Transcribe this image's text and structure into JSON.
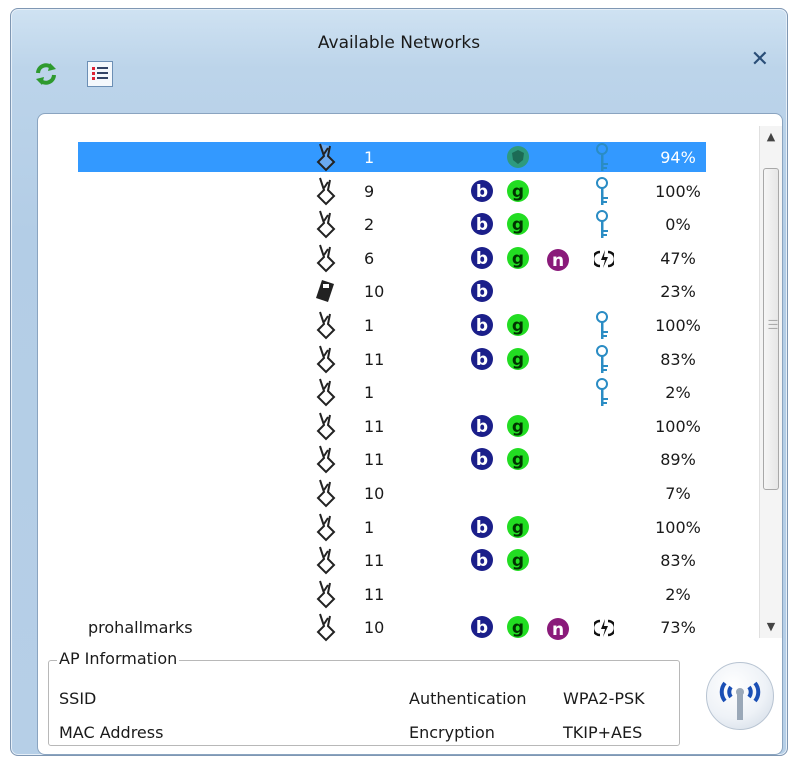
{
  "window": {
    "title": "Available Networks"
  },
  "toolbar": {
    "refresh_icon": "refresh-icon",
    "list_icon": "list-view-icon",
    "close_label": "✕"
  },
  "colors": {
    "selection": "#3399ff",
    "b_badge": "#1b1f8a",
    "g_badge": "#22dd22",
    "n_badge": "#8a1a7a",
    "key": "#2a8cc4"
  },
  "networks": [
    {
      "ssid": "",
      "type": "infrastructure",
      "channel": "1",
      "b": false,
      "g": false,
      "n": false,
      "special": "shield",
      "secured": true,
      "signal": "94%",
      "selected": true
    },
    {
      "ssid": "",
      "type": "infrastructure",
      "channel": "9",
      "b": true,
      "g": true,
      "n": false,
      "secured": true,
      "signal": "100%"
    },
    {
      "ssid": "",
      "type": "infrastructure",
      "channel": "2",
      "b": true,
      "g": true,
      "n": false,
      "secured": true,
      "signal": "0%"
    },
    {
      "ssid": "",
      "type": "infrastructure",
      "channel": "6",
      "b": true,
      "g": true,
      "n": true,
      "wps": true,
      "secured": false,
      "signal": "47%"
    },
    {
      "ssid": "",
      "type": "adhoc",
      "channel": "10",
      "b": true,
      "g": false,
      "n": false,
      "secured": false,
      "signal": "23%"
    },
    {
      "ssid": "",
      "type": "infrastructure",
      "channel": "1",
      "b": true,
      "g": true,
      "n": false,
      "secured": true,
      "signal": "100%"
    },
    {
      "ssid": "",
      "type": "infrastructure",
      "channel": "11",
      "b": true,
      "g": true,
      "n": false,
      "secured": true,
      "signal": "83%"
    },
    {
      "ssid": "",
      "type": "infrastructure",
      "channel": "1",
      "b": false,
      "g": false,
      "n": false,
      "secured": true,
      "signal": "2%"
    },
    {
      "ssid": "",
      "type": "infrastructure",
      "channel": "11",
      "b": true,
      "g": true,
      "n": false,
      "secured": false,
      "signal": "100%"
    },
    {
      "ssid": "",
      "type": "infrastructure",
      "channel": "11",
      "b": true,
      "g": true,
      "n": false,
      "secured": false,
      "signal": "89%"
    },
    {
      "ssid": "",
      "type": "infrastructure",
      "channel": "10",
      "b": false,
      "g": false,
      "n": false,
      "secured": false,
      "signal": "7%"
    },
    {
      "ssid": "",
      "type": "infrastructure",
      "channel": "1",
      "b": true,
      "g": true,
      "n": false,
      "secured": false,
      "signal": "100%"
    },
    {
      "ssid": "",
      "type": "infrastructure",
      "channel": "11",
      "b": true,
      "g": true,
      "n": false,
      "secured": false,
      "signal": "83%"
    },
    {
      "ssid": "",
      "type": "infrastructure",
      "channel": "11",
      "b": false,
      "g": false,
      "n": false,
      "secured": false,
      "signal": "2%"
    },
    {
      "ssid": "prohallmarks",
      "type": "infrastructure",
      "channel": "10",
      "b": true,
      "g": true,
      "n": true,
      "wps": true,
      "secured": false,
      "signal": "73%"
    }
  ],
  "ap_info": {
    "legend": "AP Information",
    "ssid_label": "SSID",
    "ssid_value": "",
    "mac_label": "MAC Address",
    "mac_value": "",
    "auth_label": "Authentication",
    "auth_value": "WPA2-PSK",
    "enc_label": "Encryption",
    "enc_value": "TKIP+AES"
  }
}
